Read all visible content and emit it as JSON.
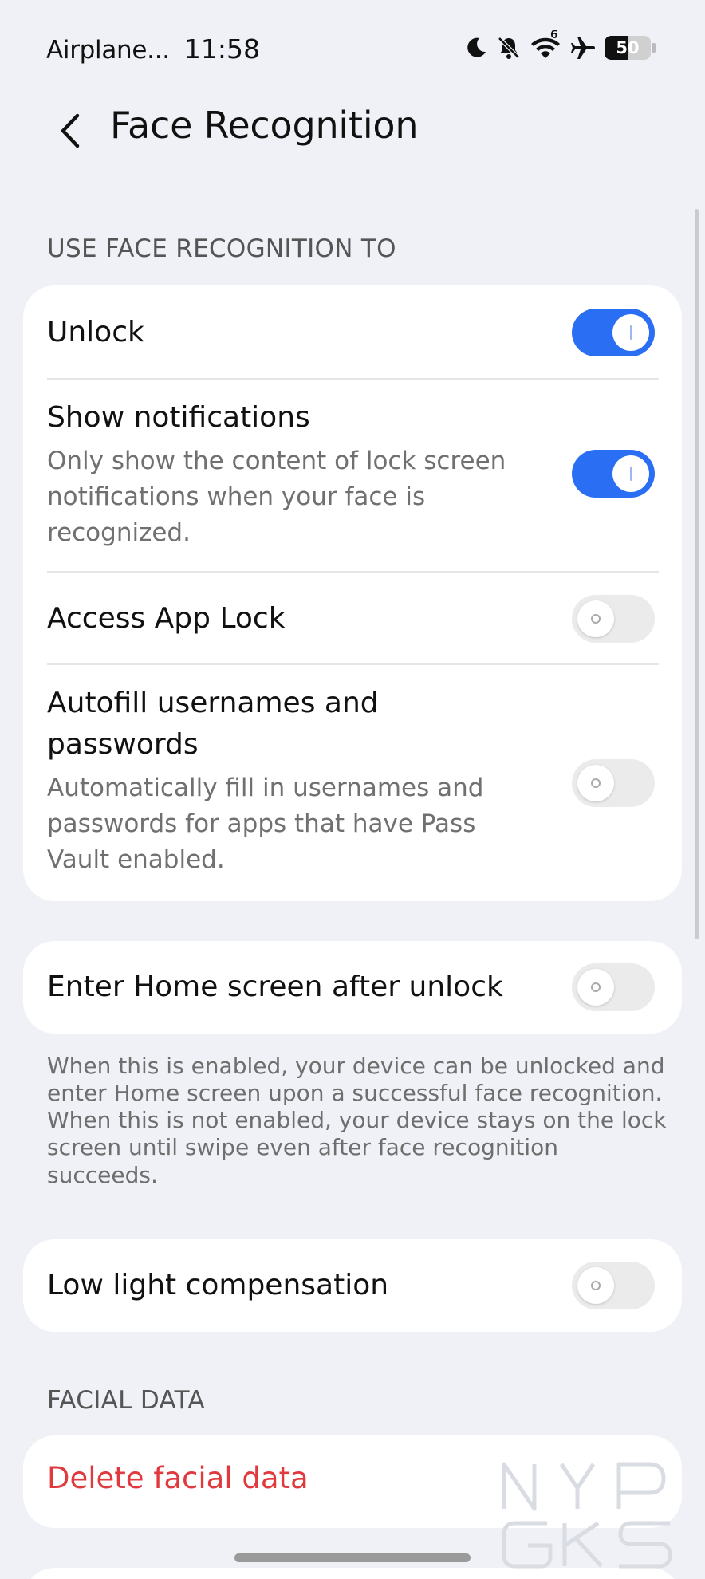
{
  "status_bar": {
    "carrier": "Airplane...",
    "time": "11:58",
    "wifi_badge": "6",
    "battery_level": "50",
    "battery_fraction": 0.5,
    "icons": [
      "moon-icon",
      "bell-muted-icon",
      "wifi-icon",
      "airplane-icon",
      "battery-icon"
    ]
  },
  "header": {
    "title": "Face Recognition",
    "back_icon": "chevron-left-icon"
  },
  "sections": {
    "use_face": "USE FACE RECOGNITION TO",
    "facial_data": "FACIAL DATA"
  },
  "settings": {
    "unlock": {
      "title": "Unlock",
      "enabled": true
    },
    "show_notifications": {
      "title": "Show notifications",
      "description": "Only show the content of lock screen notifications when your face is recognized.",
      "enabled": true
    },
    "access_app_lock": {
      "title": "Access App Lock",
      "enabled": false
    },
    "autofill": {
      "title": "Autofill usernames and passwords",
      "description": "Automatically fill in usernames and passwords for apps that have Pass Vault enabled.",
      "enabled": false
    },
    "enter_home": {
      "title": "Enter Home screen after unlock",
      "enabled": false,
      "footnote": "When this is enabled, your device can be unlocked and enter Home screen upon a successful face recognition. When this is not enabled, your device stays on the lock screen until swipe even after face recognition succeeds."
    },
    "low_light": {
      "title": "Low light compensation",
      "enabled": false
    }
  },
  "facial_data": {
    "delete_label": "Delete facial data"
  },
  "watermark": {
    "text": "NYP GKS"
  },
  "colors": {
    "accent": "#2a6ef3",
    "danger": "#e0393e",
    "background": "#eff1f7",
    "card": "#ffffff"
  }
}
